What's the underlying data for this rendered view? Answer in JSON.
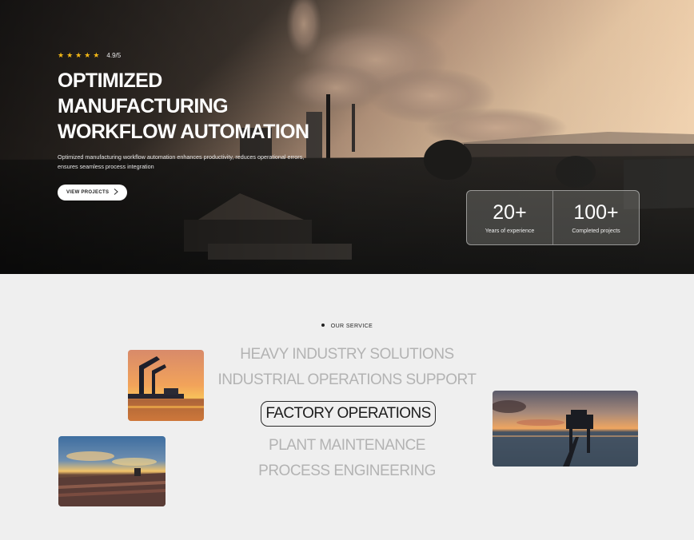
{
  "hero": {
    "rating_stars": [
      "★",
      "★",
      "★",
      "★",
      "★"
    ],
    "rating_value": "4.9/5",
    "title_line1": "OPTIMIZED MANUFACTURING",
    "title_line2": "WORKFLOW AUTOMATION",
    "description_line1": "Optimized manufacturing workflow automation enhances productivity, reduces operational errors,",
    "description_line2": "ensures seamless process integration",
    "cta_label": "VIEW PROJECTS",
    "cta_icon": "chevron-right-icon"
  },
  "stats": [
    {
      "number": "20+",
      "label": "Years of experience"
    },
    {
      "number": "100+",
      "label": "Completed projects"
    }
  ],
  "services": {
    "tag": "OUR SERVICE",
    "items": [
      "HEAVY INDUSTRY SOLUTIONS",
      "INDUSTRIAL OPERATIONS SUPPORT",
      "FACTORY OPERATIONS",
      "PLANT MAINTENANCE",
      "PROCESS ENGINEERING"
    ],
    "active_index": 2
  },
  "colors": {
    "star": "#f5b916",
    "inactive_service": "#b3b3b3",
    "active_service": "#1d1d1d",
    "background": "#efefef"
  }
}
